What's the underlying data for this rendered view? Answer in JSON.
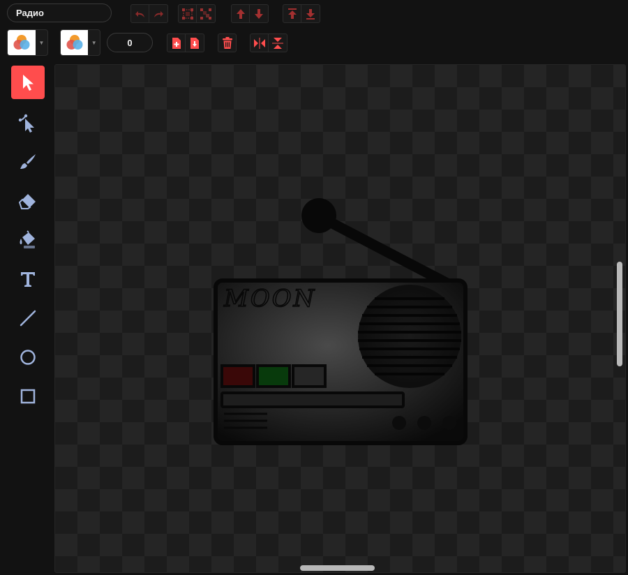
{
  "costume": {
    "name_value": "Радио"
  },
  "outline": {
    "width_value": "0"
  },
  "toolbar_row1": [
    "undo-button",
    "redo-button",
    "group-button",
    "ungroup-button",
    "forward-button",
    "backward-button",
    "front-button",
    "back-button"
  ],
  "toolbar_row2": [
    "copy-button",
    "paste-button",
    "delete-button",
    "flip-horizontal-button",
    "flip-vertical-button"
  ],
  "tools": [
    "select",
    "reshape",
    "brush",
    "eraser",
    "fill",
    "text",
    "line",
    "circle",
    "rectangle"
  ],
  "active_tool": "select",
  "artwork": {
    "brand_text": "MOON"
  },
  "colors": {
    "accent": "#ff4d4d",
    "icon": "#a0b4dd"
  }
}
